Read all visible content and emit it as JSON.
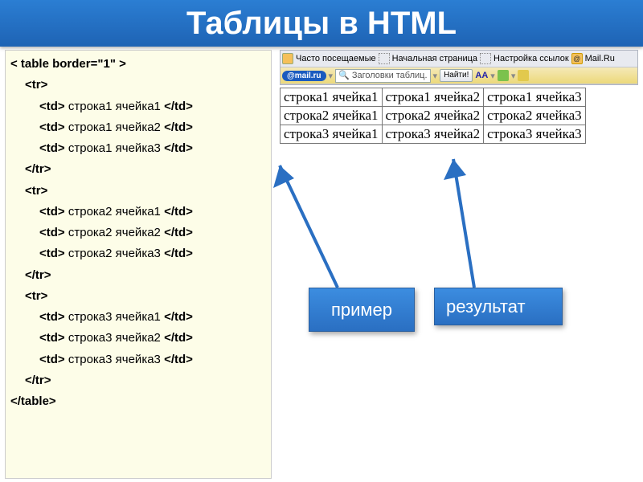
{
  "title": "Таблицы в HTML",
  "code": {
    "l0": "< table border=\"1\" >",
    "tr_open": "<tr>",
    "tr_close": "</tr>",
    "table_close": "</table>",
    "r1c1_open": "<td>",
    "r1c1_text": " строка1 ячейка1 ",
    "r1c1_close": "</td>",
    "r1c2_open": "<td>",
    "r1c2_text": " строка1 ячейка2 ",
    "r1c2_close": "</td>",
    "r1c3_open": "<td>",
    "r1c3_text": " строка1 ячейка3 ",
    "r1c3_close": "</td>",
    "r2c1_open": "<td>",
    "r2c1_text": " строка2 ячейка1 ",
    "r2c1_close": "</td>",
    "r2c2_open": "<td>",
    "r2c2_text": " строка2 ячейка2 ",
    "r2c2_close": "</td>",
    "r2c3_open": "<td>",
    "r2c3_text": " строка2 ячейка3 ",
    "r2c3_close": "</td>",
    "r3c1_open": "<td>",
    "r3c1_text": " строка3 ячейка1 ",
    "r3c1_close": "</td>",
    "r3c2_open": "<td>",
    "r3c2_text": " строка3 ячейка2 ",
    "r3c2_close": "</td>",
    "r3c3_open": "<td>",
    "r3c3_text": " строка3 ячейка3 ",
    "r3c3_close": "</td>"
  },
  "browser": {
    "bookmarks": {
      "frequent": "Часто посещаемые",
      "start": "Начальная страница",
      "links": "Настройка ссылок",
      "mailru": "Mail.Ru"
    },
    "toolbar": {
      "brand": "@mail.ru",
      "search_value": "Заголовки таблиц.",
      "find": "Найти!",
      "aa": "AA"
    }
  },
  "table": {
    "rows": [
      [
        "строка1 ячейка1",
        "строка1 ячейка2",
        "строка1 ячейка3"
      ],
      [
        "строка2 ячейка1",
        "строка2 ячейка2",
        "строка2 ячейка3"
      ],
      [
        "строка3 ячейка1",
        "строка3 ячейка2",
        "строка3 ячейка3"
      ]
    ]
  },
  "callouts": {
    "example": "пример",
    "result": "результат"
  }
}
